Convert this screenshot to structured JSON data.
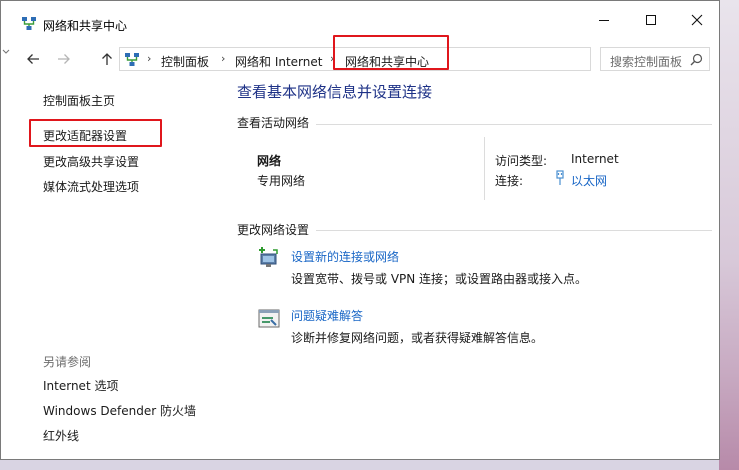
{
  "window": {
    "title": "网络和共享中心"
  },
  "nav": {
    "breadcrumbs": [
      "控制面板",
      "网络和 Internet",
      "网络和共享中心"
    ],
    "search_placeholder": "搜索控制面板"
  },
  "sidebar": {
    "items": [
      "控制面板主页",
      "更改适配器设置",
      "更改高级共享设置",
      "媒体流式处理选项"
    ],
    "see_also_heading": "另请参阅",
    "see_also": [
      "Internet 选项",
      "Windows Defender 防火墙",
      "红外线"
    ]
  },
  "main": {
    "title": "查看基本网络信息并设置连接",
    "active_networks_heading": "查看活动网络",
    "network": {
      "name": "网络",
      "category": "专用网络",
      "access_type_label": "访问类型:",
      "access_type_value": "Internet",
      "connections_label": "连接:",
      "connections_value": "以太网"
    },
    "change_settings_heading": "更改网络设置",
    "tasks": [
      {
        "title": "设置新的连接或网络",
        "description": "设置宽带、拨号或 VPN 连接；或设置路由器或接入点。"
      },
      {
        "title": "问题疑难解答",
        "description": "诊断并修复网络问题，或者获得疑难解答信息。"
      }
    ]
  },
  "colors": {
    "link": "#1866c6",
    "title": "#1e3287",
    "highlight": "#e0161c"
  }
}
